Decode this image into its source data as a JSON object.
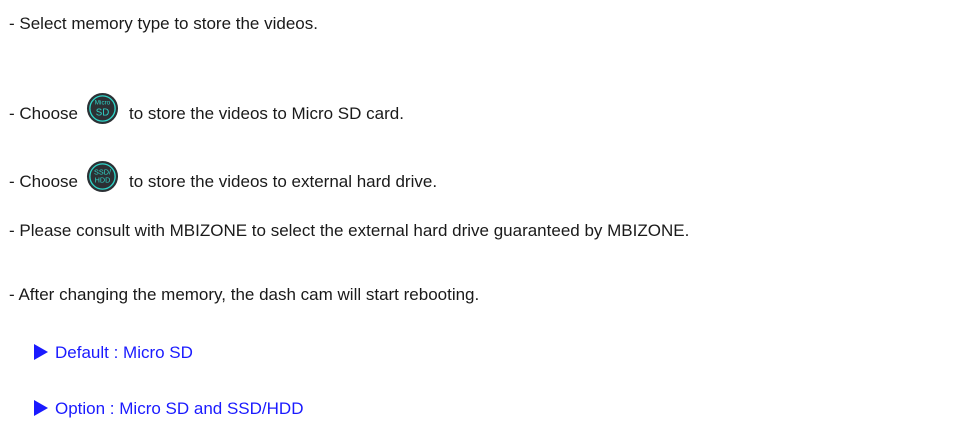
{
  "lines": {
    "select": "- Select memory type to store the videos.",
    "choose1_prefix": "- Choose",
    "choose1_suffix": "to store the videos to Micro SD card.",
    "choose2_prefix": "- Choose",
    "choose2_suffix": "to store the videos to external hard drive.",
    "consult": "- Please consult with MBIZONE to select the external hard drive guaranteed by MBIZONE.",
    "reboot": "- After changing the memory, the dash cam will start rebooting.",
    "default": "Default : Micro SD",
    "option": "Option : Micro SD and SSD/HDD"
  },
  "icons": {
    "microsd": {
      "name": "micro-sd-icon",
      "top_text": "Micro",
      "bottom_text": "SD"
    },
    "ssdhdd": {
      "name": "ssd-hdd-icon",
      "top_text": "SSD/",
      "bottom_text": "HDD"
    }
  },
  "colors": {
    "text": "#1a1a1a",
    "link": "#1a1aff",
    "icon_bg": "#2c3034",
    "icon_accent": "#2fd4c8"
  }
}
